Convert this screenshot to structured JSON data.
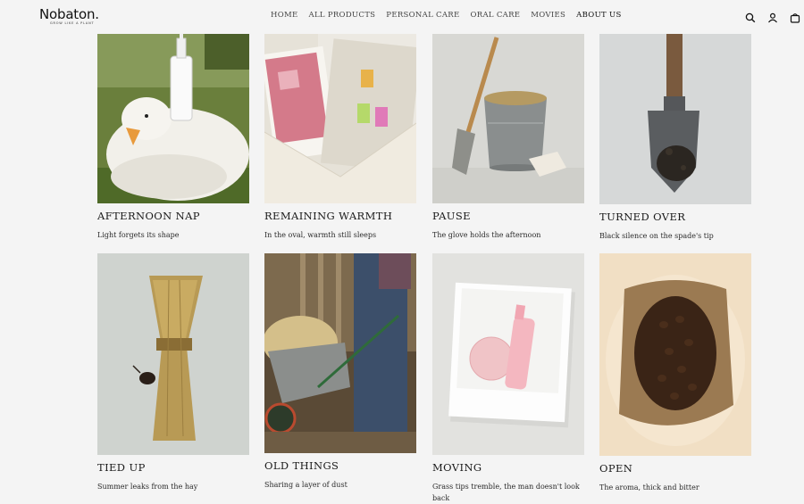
{
  "brand": {
    "name": "Nobaton.",
    "tagline": "GROW LIKE A PLANT"
  },
  "nav": {
    "items": [
      {
        "label": "HOME"
      },
      {
        "label": "ALL PRODUCTS"
      },
      {
        "label": "PERSONAL CARE"
      },
      {
        "label": "ORAL CARE"
      },
      {
        "label": "MOVIES"
      },
      {
        "label": "ABOUT US",
        "active": true
      }
    ]
  },
  "header_icons": [
    "search-icon",
    "account-icon",
    "cart-icon"
  ],
  "cards": [
    {
      "title": "AFTERNOON NAP",
      "caption": "Light forgets its shape"
    },
    {
      "title": "REMAINING WARMTH",
      "caption": "In the oval, warmth still sleeps"
    },
    {
      "title": "PAUSE",
      "caption": "The glove holds the afternoon"
    },
    {
      "title": "TURNED OVER",
      "caption": "Black silence on the spade's tip"
    },
    {
      "title": "TIED UP",
      "caption": "Summer leaks from the hay"
    },
    {
      "title": "OLD THINGS",
      "caption": "Sharing a layer of dust"
    },
    {
      "title": "MOVING",
      "caption": "Grass tips tremble, the man doesn't look back"
    },
    {
      "title": "OPEN",
      "caption": "The aroma, thick and bitter"
    }
  ],
  "colors": {
    "background": "#f4f4f4",
    "text": "#1c1c1c"
  }
}
